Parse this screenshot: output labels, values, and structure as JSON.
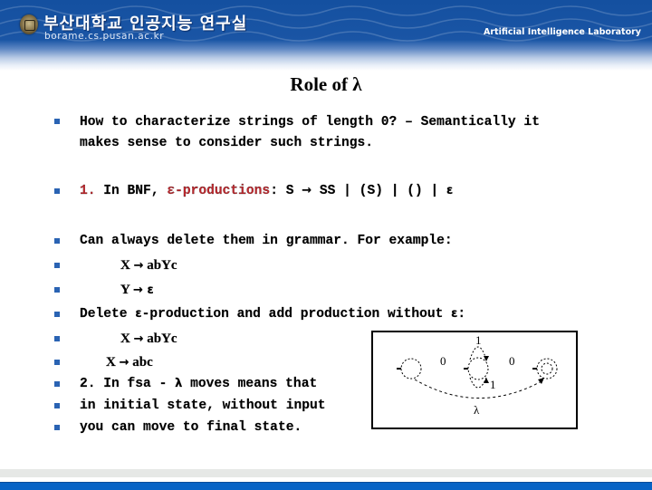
{
  "header": {
    "lab_name_korean": "부산대학교 인공지능 연구실",
    "lab_url": "borame.cs.pusan.ac.kr",
    "lab_name_english": "Artificial Intelligence Laboratory",
    "brand_color": "#1450a0",
    "emblem_icon": "university-emblem-icon"
  },
  "slide": {
    "title": "Role of λ",
    "bullet_color": "#2a63b3",
    "accent_color": "#c0272d",
    "bullets": [
      {
        "line1": "How to characterize strings of length 0? – Semantically it",
        "line2": "makes sense to consider such strings."
      },
      {
        "num": "1.",
        "pre": " In BNF, ",
        "term": "ε-productions",
        "rest_a": ": S ",
        "arrow": "→",
        "rest_b": " SS | (S) | () | ",
        "eps": "ε"
      },
      {
        "text": "Can always delete them in grammar. For example:"
      },
      {
        "lhs": "X ",
        "arrow": "→",
        "rhs": " abYc"
      },
      {
        "lhs": "Y ",
        "arrow": "→",
        "rhs": " ε"
      },
      {
        "a": "Delete ",
        "eps1": "ε",
        "b": "-production and add production without ",
        "eps2": "ε",
        "c": ":"
      },
      {
        "lhs": "X ",
        "arrow": "→",
        "rhs": " abYc"
      },
      {
        "lhs": "X ",
        "arrow": "→",
        "rhs": " abc"
      },
      {
        "a": "2. In fsa - ",
        "lambda": "λ",
        "b": " moves means that"
      },
      {
        "text": "in initial state, without input"
      },
      {
        "text": "you can move to final state."
      }
    ]
  },
  "fsa_diagram": {
    "labels": {
      "transition_q0_q1": "0",
      "transition_q1_q2": "0",
      "self_loop_top": "1",
      "self_loop_bottom": "1",
      "lambda_transition": "λ"
    },
    "states": [
      "initial",
      "middle",
      "final"
    ]
  }
}
